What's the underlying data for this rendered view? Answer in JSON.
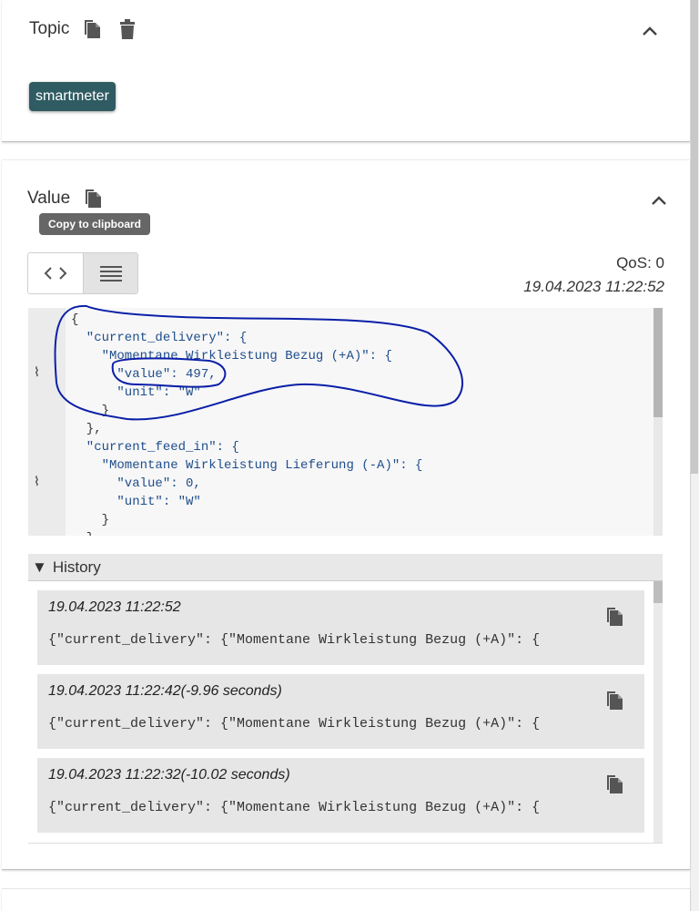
{
  "topic": {
    "label": "Topic",
    "chip": "smartmeter"
  },
  "value": {
    "label": "Value",
    "tooltip": "Copy to clipboard",
    "qos": "QoS: 0",
    "timestamp": "19.04.2023 11:22:52",
    "code_lines": [
      "{",
      "  \"current_delivery\": {",
      "    \"Momentane Wirkleistung Bezug (+A)\": {",
      "      \"value\": 497,",
      "      \"unit\": \"W\"",
      "    }",
      "  },",
      "  \"current_feed_in\": {",
      "    \"Momentane Wirkleistung Lieferung (-A)\": {",
      "      \"value\": 0,",
      "      \"unit\": \"W\"",
      "    }",
      "  }"
    ]
  },
  "history": {
    "label": "History",
    "items": [
      {
        "time": "19.04.2023 11:22:52",
        "payload": "{\"current_delivery\": {\"Momentane Wirkleistung Bezug (+A)\": {"
      },
      {
        "time": "19.04.2023 11:22:42(-9.96 seconds)",
        "payload": "{\"current_delivery\": {\"Momentane Wirkleistung Bezug (+A)\": {"
      },
      {
        "time": "19.04.2023 11:22:32(-10.02 seconds)",
        "payload": "{\"current_delivery\": {\"Momentane Wirkleistung Bezug (+A)\": {"
      }
    ]
  },
  "colors": {
    "chip_bg": "#2f5b63",
    "annotation": "#0b1fa8"
  }
}
